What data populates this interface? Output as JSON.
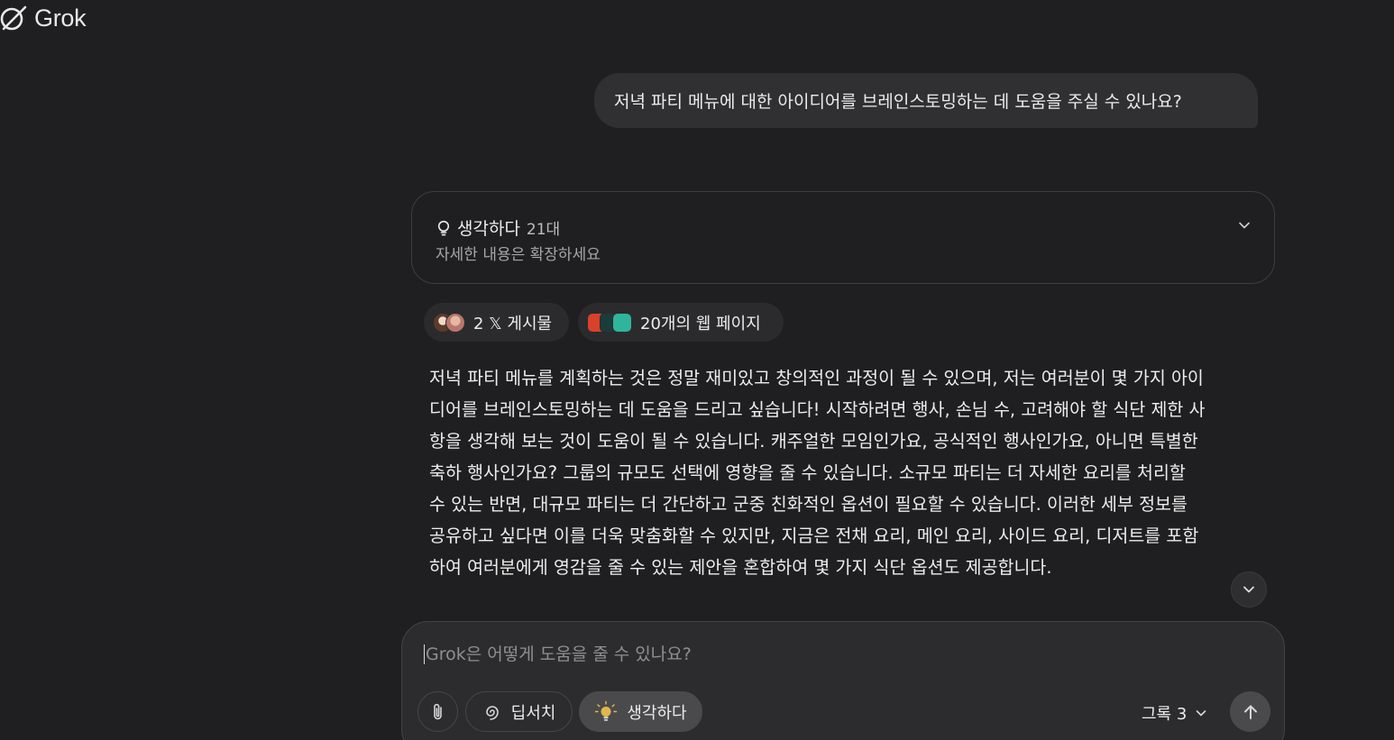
{
  "app": {
    "logo_text": "Grok"
  },
  "user_message": "저녁 파티 메뉴에 대한 아이디어를 브레인스토밍하는 데 도움을 주실 수 있나요?",
  "thinking": {
    "label": "생각하다",
    "duration": "21대",
    "hint": "자세한 내용은 확장하세요",
    "icon": "lightbulb-icon"
  },
  "sources": {
    "x_posts_label": "2 𝕏 게시물",
    "web_pages_label": "20개의 웹 페이지"
  },
  "answer_lines": [
    "저녁 파티 메뉴를 계획하는 것은 정말 재미있고 창의적인 과정이 될 수 있으며, 저는 여러분이 몇 가지 아이",
    "디어를 브레인스토밍하는 데 도움을 드리고 싶습니다! 시작하려면 행사, 손님 수, 고려해야 할 식단 제한 사",
    "항을 생각해 보는 것이 도움이 될 수 있습니다. 캐주얼한 모임인가요, 공식적인 행사인가요, 아니면 특별한",
    "축하 행사인가요? 그룹의 규모도 선택에 영향을 줄 수 있습니다. 소규모 파티는 더 자세한 요리를 처리할",
    "수 있는 반면, 대규모 파티는 더 간단하고 군중 친화적인 옵션이 필요할 수 있습니다. 이러한 세부 정보를",
    "공유하고 싶다면 이를 더욱 맞춤화할 수 있지만, 지금은 전채 요리, 메인 요리, 사이드 요리, 디저트를 포함",
    "하여 여러분에게 영감을 줄 수 있는 제안을 혼합하여 몇 가지 식단 옵션도 제공합니다."
  ],
  "composer": {
    "placeholder": "Grok은 어떻게 도움을 줄 수 있나요?",
    "deepsearch_label": "딥서치",
    "think_label": "생각하다",
    "model_label": "그록 3"
  },
  "colors": {
    "background": "#1f1f21",
    "bubble": "#303032",
    "composer": "#2c2c2e",
    "think_active": "#4a4a4d"
  }
}
